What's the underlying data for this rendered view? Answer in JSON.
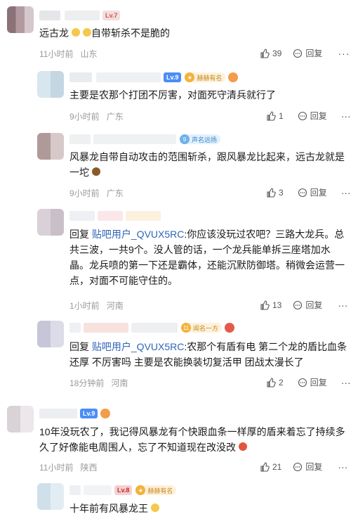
{
  "comments": [
    {
      "level": "Lv.7",
      "text_before": "远古龙",
      "text_after": "自带斩杀不是脆的",
      "time": "11小时前",
      "location": "山东",
      "likes": "39",
      "reply_label": "回复"
    },
    {
      "level": "Lv.9",
      "medal": "赫赫有名",
      "text": "主要是农那个打团不厉害，对面死守清兵就行了",
      "time": "9小时前",
      "location": "广东",
      "likes": "1",
      "reply_label": "回复"
    },
    {
      "medal_level": "9",
      "medal": "声名远扬",
      "text": "风暴龙自带自动攻击的范围斩杀，跟风暴龙比起来，远古龙就是一坨",
      "time": "9小时前",
      "location": "广东",
      "likes": "3",
      "reply_label": "回复"
    },
    {
      "reply_prefix": "回复",
      "mention": "贴吧用户_QVUX5RC",
      "text": ":你应该没玩过农吧？三路大龙兵。总共三波，一共9个。没人管的话，一个龙兵能单拆三座塔加水晶。龙兵喷的第一下还是霸体，还能沉默防御塔。稍微会运营一点，对面不可能守住的。",
      "time": "1小时前",
      "location": "河南",
      "likes": "13",
      "reply_label": "回复"
    },
    {
      "medal_level": "11",
      "medal": "闻名一方",
      "reply_prefix": "回复",
      "mention": "贴吧用户_QVUX5RC",
      "text": ":农那个有盾有电 第二个龙的盾比血条还厚 不厉害吗 主要是农能换装切复活甲 团战太漫长了",
      "time": "18分钟前",
      "location": "河南",
      "likes": "2",
      "reply_label": "回复"
    },
    {
      "level": "Lv.9",
      "text": "10年没玩农了，我记得风暴龙有个快跟血条一样厚的盾来着忘了持续多久了好像能电周围人，忘了不知道现在改没改",
      "time": "11小时前",
      "location": "陕西",
      "likes": "21",
      "reply_label": "回复"
    },
    {
      "level": "Lv.8",
      "medal": "赫赫有名",
      "text": "十年前有风暴龙王"
    }
  ],
  "colors": {
    "mention": "#2f65b8",
    "meta": "#9a9a9a",
    "sub_bg": "#f7f8fa"
  }
}
